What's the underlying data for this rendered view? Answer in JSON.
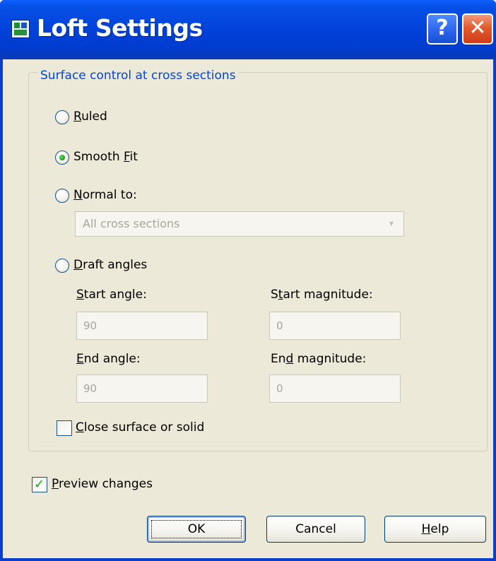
{
  "window": {
    "title": "Loft Settings",
    "help_glyph": "?",
    "close_glyph": "✕",
    "icon": "autocad-app-icon",
    "colors": {
      "titlebar": "#0140d8",
      "client": "#ece9d8",
      "group_title": "#0046d5",
      "disabled_text": "#a7a69b"
    }
  },
  "group": {
    "title": "Surface control at cross sections"
  },
  "options": {
    "ruled": {
      "label_pre": "",
      "label_key": "R",
      "label_post": "uled",
      "selected": false
    },
    "smooth_fit": {
      "label_pre": "Smooth ",
      "label_key": "F",
      "label_post": "it",
      "selected": true
    },
    "normal_to": {
      "label_pre": "",
      "label_key": "N",
      "label_post": "ormal to:",
      "selected": false
    },
    "draft_angles": {
      "label_pre": "",
      "label_key": "D",
      "label_post": "raft angles",
      "selected": false
    }
  },
  "normal_to_select": {
    "value": "All cross sections",
    "arrow": "▾",
    "disabled": true
  },
  "draft": {
    "start_angle": {
      "label_pre": "",
      "label_key": "S",
      "label_post": "tart angle:",
      "value": "90"
    },
    "start_magnitude": {
      "label_pre": "S",
      "label_key": "t",
      "label_post": "art magnitude:",
      "value": "0"
    },
    "end_angle": {
      "label_pre": "",
      "label_key": "E",
      "label_post": "nd angle:",
      "value": "90"
    },
    "end_magnitude": {
      "label_pre": "En",
      "label_key": "d",
      "label_post": " magnitude:",
      "value": "0"
    }
  },
  "close_surface": {
    "label_pre": "",
    "label_key": "C",
    "label_post": "lose surface or solid",
    "checked": false
  },
  "preview_changes": {
    "label_pre": "",
    "label_key": "P",
    "label_post": "review changes",
    "checked": true,
    "check_glyph": "✓"
  },
  "buttons": {
    "ok": "OK",
    "cancel": "Cancel",
    "help": {
      "label_pre": "",
      "label_key": "H",
      "label_post": "elp"
    }
  }
}
